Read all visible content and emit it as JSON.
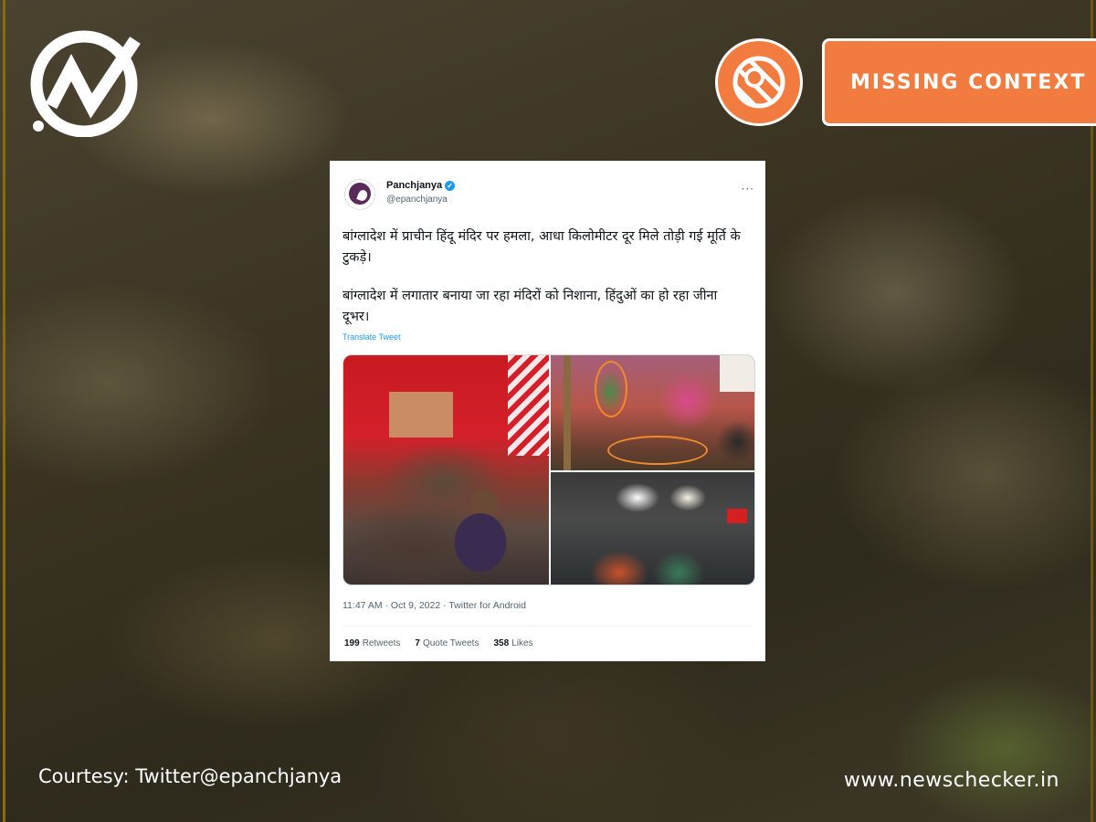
{
  "brand": {
    "logo_icon": "newschecker-check-logo-icon"
  },
  "verdict": {
    "label": "MISSING CONTEXT",
    "icon": "magnifier-stripe-icon",
    "color": "#f27b3f"
  },
  "tweet": {
    "display_name": "Panchjanya",
    "handle": "@epanchjanya",
    "verified_icon": "verified-badge-icon",
    "more_icon": "more-dots-icon",
    "more": "···",
    "paragraph_1": "बांग्लादेश में प्राचीन हिंदू मंदिर पर हमला, आधा किलोमीटर दूर मिले तोड़ी गई मूर्ति के टुकड़े।",
    "paragraph_2": "बांग्लादेश में लगातार बनाया जा रहा मंदिरों को निशाना, हिंदुओं का हो रहा जीना दूभर।",
    "translate": "Translate Tweet",
    "timestamp": "11:47 AM · Oct 9, 2022 · Twitter for Android",
    "stats": {
      "retweets_count": "199",
      "retweets_label": "Retweets",
      "quotes_count": "7",
      "quotes_label": "Quote Tweets",
      "likes_count": "358",
      "likes_label": "Likes"
    }
  },
  "footer": {
    "courtesy": "Courtesy: Twitter@epanchjanya",
    "site": "www.newschecker.in"
  }
}
